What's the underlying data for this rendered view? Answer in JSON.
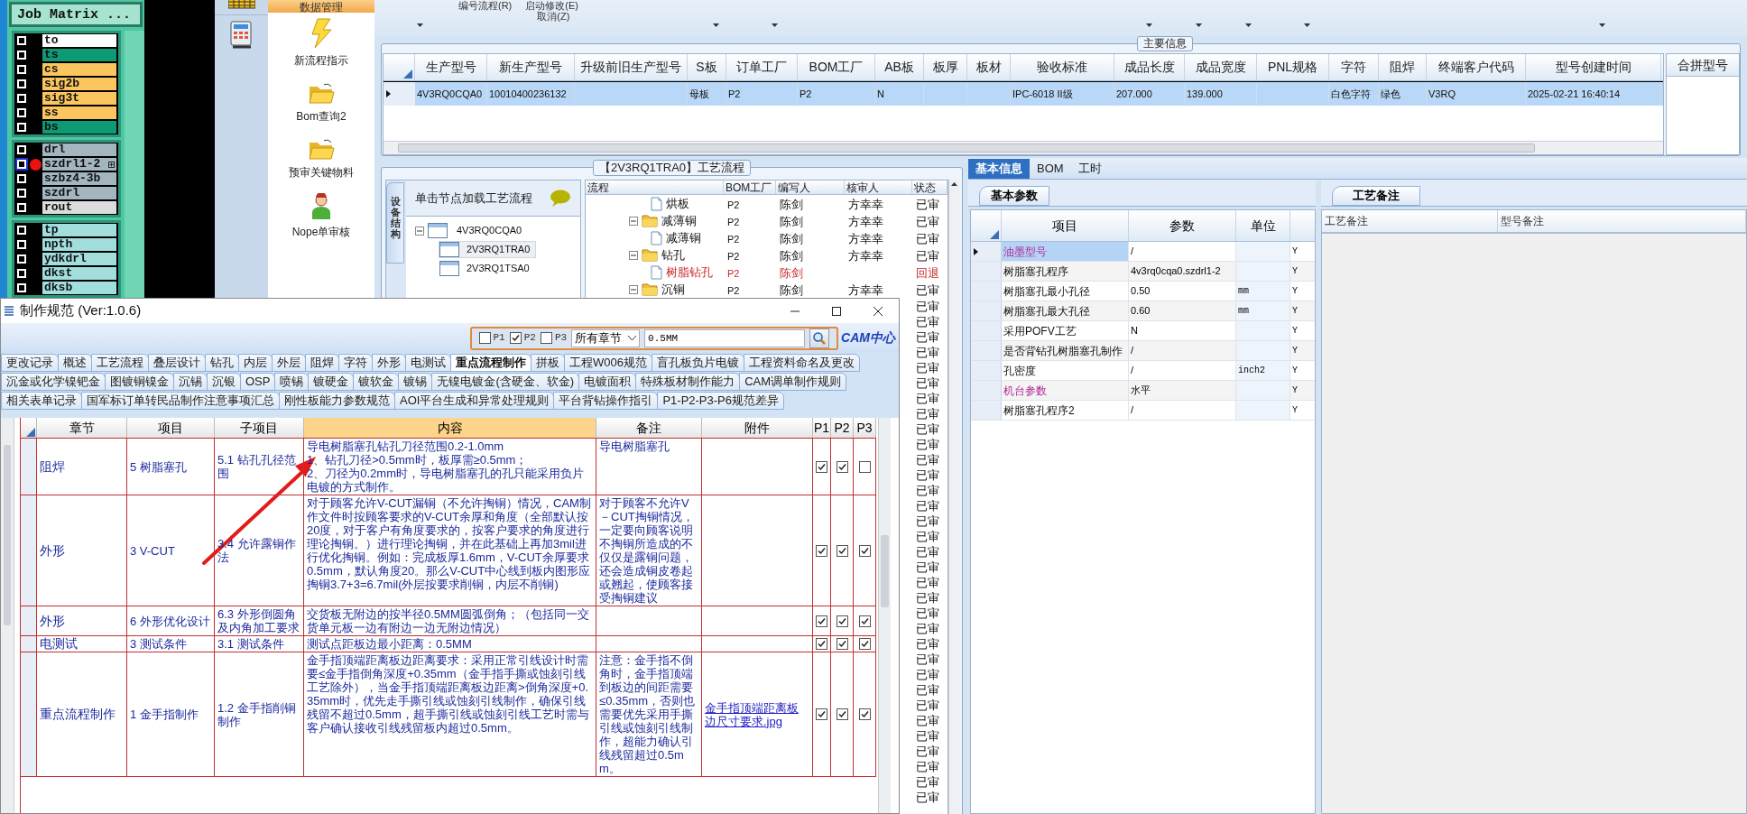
{
  "toolbar": {
    "menus": [
      "编号流程(R)",
      "启动修改(E)",
      "取消(Z)"
    ]
  },
  "job_matrix": {
    "title": "Job Matrix ...",
    "groups": [
      [
        {
          "name": "to",
          "color": "#ffffff",
          "selected": false,
          "checked": false
        },
        {
          "name": "ts",
          "color": "#0d9a74",
          "selected": false,
          "checked": false
        },
        {
          "name": "cs",
          "color": "#fcc65e",
          "selected": false,
          "checked": false
        },
        {
          "name": "sig2b",
          "color": "#fcc65e",
          "selected": false,
          "checked": false
        },
        {
          "name": "sig3t",
          "color": "#fcc65e",
          "selected": false,
          "checked": false
        },
        {
          "name": "ss",
          "color": "#fcc65e",
          "selected": false,
          "checked": false
        },
        {
          "name": "bs",
          "color": "#0d9a74",
          "selected": false,
          "checked": false
        }
      ],
      [
        {
          "name": "drl",
          "color": "#a3b6bf",
          "selected": false,
          "checked": false
        },
        {
          "name": "szdrl1-2",
          "color": "#a3b6bf",
          "selected": true,
          "checked": false
        },
        {
          "name": "szbz4-3b",
          "color": "#a3b6bf",
          "selected": false,
          "checked": false
        },
        {
          "name": "szdrl",
          "color": "#a3b6bf",
          "selected": false,
          "checked": false
        },
        {
          "name": "rout",
          "color": "#dcdcdc",
          "selected": false,
          "checked": false
        }
      ],
      [
        {
          "name": "tp",
          "color": "#a2dede",
          "selected": false,
          "checked": false
        },
        {
          "name": "npth",
          "color": "#a2dede",
          "selected": false,
          "checked": false
        },
        {
          "name": "ydkdrl",
          "color": "#a2dede",
          "selected": false,
          "checked": false
        },
        {
          "name": "dkst",
          "color": "#a2dede",
          "selected": false,
          "checked": false
        },
        {
          "name": "dksb",
          "color": "#a2dede",
          "selected": false,
          "checked": false
        }
      ]
    ]
  },
  "data_panel": {
    "title": "数据管理",
    "items": [
      {
        "label": "新流程指示",
        "kind": "bolt"
      },
      {
        "label": "Bom查询2",
        "kind": "folder"
      },
      {
        "label": "预审关键物料",
        "kind": "folder"
      },
      {
        "label": "Nope单审核",
        "kind": "person"
      }
    ]
  },
  "main_info": {
    "title": "主要信息",
    "columns": [
      "生产型号",
      "新生产型号",
      "升级前旧生产型号",
      "S板",
      "订单工厂",
      "BOM工厂",
      "AB板",
      "板厚",
      "板材",
      "验收标准",
      "成品长度",
      "成品宽度",
      "PNL规格",
      "字符",
      "阻焊",
      "终端客户代码",
      "型号创建时间"
    ],
    "rows": [
      {
        "selected": true,
        "cells": [
          "4V3RQ0CQA0",
          "10010400236132",
          "",
          "母板",
          "P2",
          "P2",
          "N",
          "",
          "",
          "IPC-6018 II级",
          "207.000",
          "139.000",
          "",
          "白色字符",
          "绿色",
          "V3RQ",
          "2025-02-21 16:40:14"
        ]
      }
    ],
    "side_column": "合拼型号"
  },
  "process": {
    "title": "【2V3RQ1TRA0】工艺流程",
    "side_tab": "设备结构",
    "hint": "单击节点加载工艺流程",
    "tree": {
      "label": "4V3RQ0CQA0",
      "expanded": true,
      "children": [
        {
          "label": "2V3RQ1TRA0",
          "selected": true
        },
        {
          "label": "2V3RQ1TSA0",
          "selected": false
        }
      ]
    },
    "columns": [
      "流程",
      "BOM工厂",
      "编写人",
      "核审人",
      "状态"
    ],
    "rows": [
      {
        "kind": "step",
        "name": "烘板",
        "bom": "P2",
        "author": "陈剑",
        "reviewer": "方幸幸",
        "status": "已审",
        "rejected": false
      },
      {
        "kind": "group",
        "name": "减薄铜",
        "bom": "P2",
        "author": "陈剑",
        "reviewer": "方幸幸",
        "status": "已审",
        "rejected": false,
        "expanded": true,
        "children": [
          {
            "kind": "step",
            "name": "减薄铜",
            "bom": "P2",
            "author": "陈剑",
            "reviewer": "方幸幸",
            "status": "已审",
            "rejected": false
          }
        ]
      },
      {
        "kind": "group",
        "name": "钻孔",
        "bom": "P2",
        "author": "陈剑",
        "reviewer": "方幸幸",
        "status": "已审",
        "rejected": false,
        "expanded": true,
        "children": [
          {
            "kind": "step",
            "name": "树脂钻孔",
            "bom": "P2",
            "author": "陈剑",
            "status": "回退",
            "rejected": true
          }
        ]
      },
      {
        "kind": "group",
        "name": "沉铜",
        "bom": "P2",
        "author": "陈剑",
        "reviewer": "方幸幸",
        "status": "已审",
        "rejected": false,
        "expanded": true
      }
    ],
    "more_status": [
      "已审",
      "已审",
      "已审",
      "已审",
      "已审",
      "已审",
      "已审",
      "已审",
      "已审",
      "已审",
      "已审",
      "已审",
      "已审",
      "已审",
      "已审",
      "已审",
      "已审",
      "已审",
      "已审",
      "已审",
      "已审",
      "已审",
      "已审",
      "已审",
      "已审",
      "已审",
      "已审",
      "已审",
      "已审",
      "已审",
      "已审",
      "已审",
      "已审"
    ]
  },
  "right_panel": {
    "tabs": [
      {
        "label": "基本信息",
        "selected": true
      },
      {
        "label": "BOM",
        "selected": false
      },
      {
        "label": "工时",
        "selected": false
      }
    ],
    "params": {
      "tab": "基本参数",
      "columns": [
        "项目",
        "参数",
        "单位"
      ],
      "rows": [
        {
          "item": "油墨型号",
          "value": "/",
          "flag": "Y",
          "highlight": true,
          "selected": true
        },
        {
          "item": "树脂塞孔程序",
          "value": "4v3rq0cqa0.szdrl1-2",
          "flag": "Y",
          "highlight": false,
          "selected": false
        },
        {
          "item": "树脂塞孔最小孔径",
          "value": "0.50",
          "unit": "mm",
          "flag": "Y",
          "highlight": false,
          "selected": false
        },
        {
          "item": "树脂塞孔最大孔径",
          "value": "0.60",
          "unit": "mm",
          "flag": "Y",
          "highlight": false,
          "selected": false
        },
        {
          "item": "采用POFV工艺",
          "value": "N",
          "flag": "Y",
          "highlight": false,
          "selected": false
        },
        {
          "item": "是否背钻孔树脂塞孔制作",
          "value": "/",
          "flag": "Y",
          "highlight": false,
          "selected": false
        },
        {
          "item": "孔密度",
          "value": "/",
          "unit": "inch2",
          "flag": "Y",
          "highlight": false,
          "selected": false
        },
        {
          "item": "机台参数",
          "value": "水平",
          "flag": "Y",
          "highlight": true,
          "selected": false
        },
        {
          "item": "树脂塞孔程序2",
          "value": "/",
          "flag": "Y",
          "highlight": false,
          "selected": false
        }
      ]
    },
    "notes": {
      "tab": "工艺备注",
      "columns": [
        "工艺备注",
        "型号备注"
      ]
    }
  },
  "dialog": {
    "title": "制作规范 (Ver:1.0.6)",
    "filters": [
      {
        "label": "P1",
        "checked": false
      },
      {
        "label": "P2",
        "checked": true
      },
      {
        "label": "P3",
        "checked": false
      }
    ],
    "chapter_select": "所有章节",
    "search": {
      "value": "0.5MM"
    },
    "logo": "CAM中心",
    "tab_rows": [
      [
        {
          "label": "更改记录",
          "selected": false
        },
        {
          "label": "概述",
          "selected": false
        },
        {
          "label": "工艺流程",
          "selected": false
        },
        {
          "label": "叠层设计",
          "selected": false
        },
        {
          "label": "钻孔",
          "selected": false
        },
        {
          "label": "内层",
          "selected": false
        },
        {
          "label": "外层",
          "selected": false
        },
        {
          "label": "阻焊",
          "selected": false
        },
        {
          "label": "字符",
          "selected": false
        },
        {
          "label": "外形",
          "selected": false
        },
        {
          "label": "电测试",
          "selected": false
        },
        {
          "label": "重点流程制作",
          "selected": true
        },
        {
          "label": "拼板",
          "selected": false
        },
        {
          "label": "工程W006规范",
          "selected": false
        },
        {
          "label": "盲孔板负片电镀",
          "selected": false
        },
        {
          "label": "工程资料命名及更改",
          "selected": false
        }
      ],
      [
        {
          "label": "沉金或化学镍钯金",
          "selected": false
        },
        {
          "label": "图镀铜镍金",
          "selected": false
        },
        {
          "label": "沉锡",
          "selected": false
        },
        {
          "label": "沉银",
          "selected": false
        },
        {
          "label": "OSP",
          "selected": false
        },
        {
          "label": "喷锡",
          "selected": false
        },
        {
          "label": "镀硬金",
          "selected": false
        },
        {
          "label": "镀软金",
          "selected": false
        },
        {
          "label": "镀锡",
          "selected": false
        },
        {
          "label": "无镍电镀金(含硬金、软金)",
          "selected": false
        },
        {
          "label": "电镀面积",
          "selected": false
        },
        {
          "label": "特殊板材制作能力",
          "selected": false
        },
        {
          "label": "CAM调单制作规则",
          "selected": false
        }
      ],
      [
        {
          "label": "相关表单记录",
          "selected": false
        },
        {
          "label": "国军标订单转民品制作注意事项汇总",
          "selected": false
        },
        {
          "label": "刚性板能力参数规范",
          "selected": false
        },
        {
          "label": "AOI平台生成和异常处理规则",
          "selected": false
        },
        {
          "label": "平台背钻操作指引",
          "selected": false
        },
        {
          "label": "P1-P2-P3-P6规范差异",
          "selected": false
        }
      ]
    ],
    "table": {
      "columns": [
        "章节",
        "项目",
        "子项目",
        "内容",
        "备注",
        "附件",
        "P1",
        "P2",
        "P3"
      ],
      "rows": [
        {
          "chapter": "阻焊",
          "item": "5 树脂塞孔",
          "subitem": "5.1 钻孔孔径范围",
          "content": "导电树脂塞孔钻孔刀径范围0.2-1.0mm\n1、钻孔刀径>0.5mm时，板厚需≥0.5mm；\n2、刀径为0.2mm时，导电树脂塞孔的孔只能采用负片电镀的方式制作。",
          "remark": "导电树脂塞孔",
          "checks": [
            true,
            true,
            false
          ]
        },
        {
          "chapter": "外形",
          "item": "3 V-CUT",
          "subitem": "3.4 允许露铜作法",
          "content": "对于顾客允许V-CUT漏铜（不允许掏铜）情况，CAM制作文件时按顾客要求的V-CUT余厚和角度（全部默认按20度，对于客户有角度要求的，按客户要求的角度进行理论掏铜。）进行理论掏铜，并在此基础上再加3mil进行优化掏铜。例如：完成板厚1.6mm，V-CUT余厚要求0.5mm，默认角度20。那么V-CUT中心线到板内图形应掏铜3.7+3=6.7mil(外层按要求削铜，内层不削铜)",
          "remark": "对于顾客不允许V－CUT掏铜情况，一定要向顾客说明不掏铜所造成的不仅仅是露铜问题，还会造成铜皮卷起或翘起，使顾客接受掏铜建议",
          "checks": [
            true,
            true,
            true
          ]
        },
        {
          "chapter": "外形",
          "item": "6 外形优化设计",
          "subitem": "6.3 外形倒圆角及内角加工要求",
          "content": "交货板无附边的按半径0.5MM圆弧倒角；（包括同一交货单元板一边有附边一边无附边情况）",
          "checks": [
            true,
            true,
            true
          ]
        },
        {
          "chapter": "电测试",
          "item": "3 测试条件",
          "subitem": "3.1 测试条件",
          "content": "测试点距板边最小距离：0.5MM",
          "checks": [
            true,
            true,
            true
          ]
        },
        {
          "chapter": "重点流程制作",
          "item": "1 金手指制作",
          "subitem": "1.2 金手指削铜制作",
          "content": "金手指顶端距离板边距离要求：采用正常引线设计时需要≤金手指倒角深度+0.35mm（金手指手撕或蚀刻引线工艺除外），当金手指顶端距离板边距离>倒角深度+0.35mm时，优先走手撕引线或蚀刻引线制作，确保引线残留不超过0.5mm，超手撕引线或蚀刻引线工艺时需与客户确认接收引线残留板内超过0.5mm。",
          "remark": "注意：金手指不倒角时，金手指顶端到板边的间距需要≤0.35mm，否则也需要优先采用手撕引线或蚀刻引线制作，超能力确认引线残留超过0.5mm。",
          "attachment": "金手指顶端距离板边尺寸要求.jpg",
          "checks": [
            true,
            true,
            true
          ]
        }
      ]
    }
  }
}
